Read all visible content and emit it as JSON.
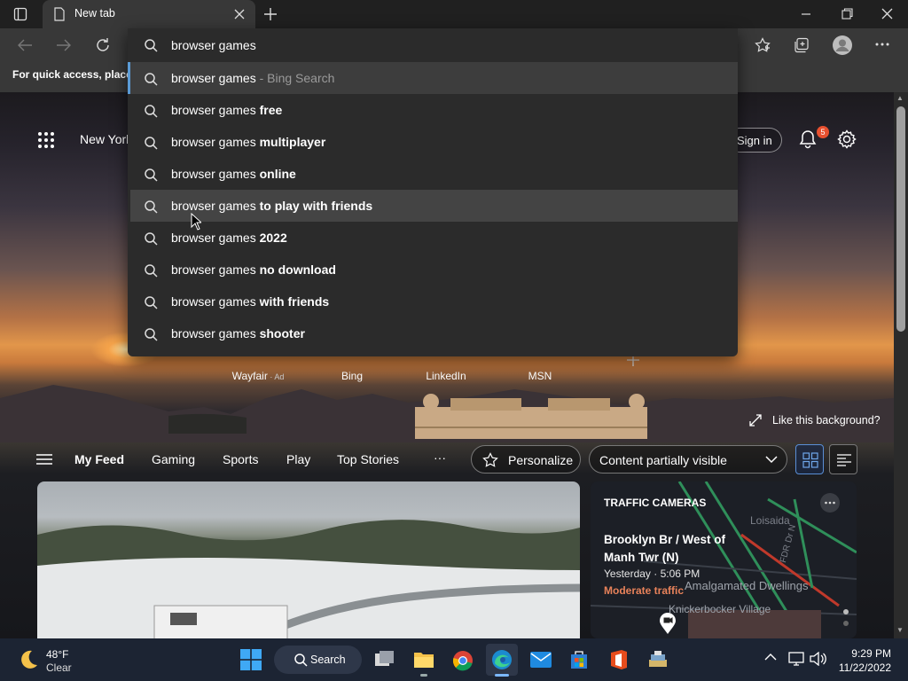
{
  "browser": {
    "tab_title": "New tab",
    "favorites_bar_text": "For quick access, place y"
  },
  "omnibox": {
    "query": "browser games",
    "suggestions": [
      {
        "prefix": "browser games",
        "suffix": "",
        "extra": " - Bing Search"
      },
      {
        "prefix": "browser games",
        "suffix": " free",
        "extra": ""
      },
      {
        "prefix": "browser games",
        "suffix": " multiplayer",
        "extra": ""
      },
      {
        "prefix": "browser games",
        "suffix": " online",
        "extra": ""
      },
      {
        "prefix": "browser games",
        "suffix": " to play with friends",
        "extra": ""
      },
      {
        "prefix": "browser games",
        "suffix": " 2022",
        "extra": ""
      },
      {
        "prefix": "browser games",
        "suffix": " no download",
        "extra": ""
      },
      {
        "prefix": "browser games",
        "suffix": " with friends",
        "extra": ""
      },
      {
        "prefix": "browser games",
        "suffix": " shooter",
        "extra": ""
      }
    ]
  },
  "page": {
    "location": "New York",
    "sign_in": "Sign in",
    "notification_count": "5",
    "quick_links": [
      "Wayfair",
      "Bing",
      "LinkedIn",
      "MSN"
    ],
    "ad_label": "Ad",
    "like_background": "Like this background?"
  },
  "feed_nav": {
    "items": [
      "My Feed",
      "Gaming",
      "Sports",
      "Play",
      "Top Stories"
    ],
    "more": "···",
    "personalize": "Personalize",
    "visibility": "Content partially visible"
  },
  "traffic_card": {
    "header": "TRAFFIC CAMERAS",
    "title": "Brooklyn Br / West of Manh Twr (N)",
    "time": "Yesterday · 5:06 PM",
    "status": "Moderate traffic",
    "map_labels": [
      "Loisaida",
      "FDR Dr N",
      "Amalgamated Dwellings",
      "Knickerbocker Village"
    ]
  },
  "taskbar": {
    "weather_temp": "48°F",
    "weather_desc": "Clear",
    "search_label": "Search",
    "time": "9:29 PM",
    "date": "11/22/2022"
  },
  "colors": {
    "accent": "#5b9bd5",
    "badge": "#e8502f",
    "traffic_status": "#e8825a"
  }
}
